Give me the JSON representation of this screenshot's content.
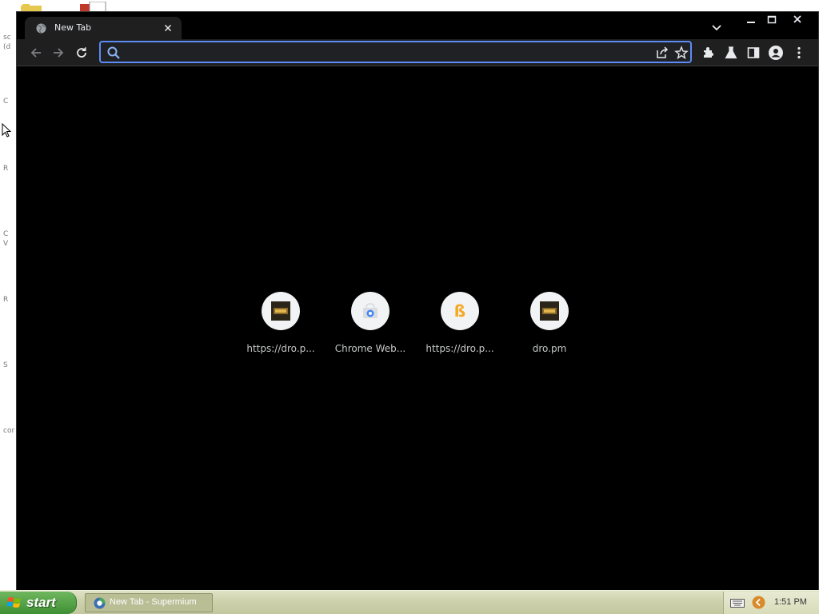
{
  "window": {
    "tab_title": "New Tab"
  },
  "omnibox": {
    "value": "",
    "placeholder": ""
  },
  "shortcuts": [
    {
      "label": "https://dro.p...",
      "icon": "dro-pm-favicon"
    },
    {
      "label": "Chrome Web...",
      "icon": "chrome-web-store-icon"
    },
    {
      "label": "https://dro.p...",
      "icon": "bitcoin-icon"
    },
    {
      "label": "dro.pm",
      "icon": "dro-pm-favicon"
    }
  ],
  "taskbar": {
    "start_label": "start",
    "task_label": "New Tab - Supermium",
    "clock": "1:51 PM"
  },
  "colors": {
    "accent": "#5b8cf5",
    "page_background": "#000000",
    "toolbar_background": "#1f1f1f",
    "taskbar": "#cdd2ad",
    "start_button": "#3f8f34"
  }
}
